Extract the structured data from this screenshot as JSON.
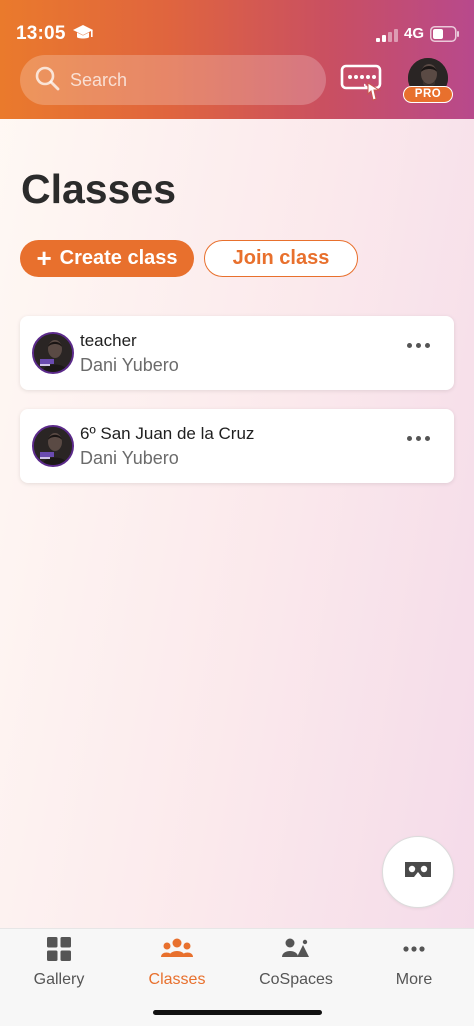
{
  "status_bar": {
    "time": "13:05",
    "network": "4G"
  },
  "header": {
    "search_placeholder": "Search",
    "pro_badge": "PRO"
  },
  "page": {
    "title": "Classes",
    "create_button": "Create class",
    "join_button": "Join class"
  },
  "classes": [
    {
      "name": "teacher",
      "owner": "Dani Yubero"
    },
    {
      "name": "6º San Juan de la Cruz",
      "owner": "Dani Yubero"
    }
  ],
  "tabbar": {
    "items": [
      {
        "label": "Gallery",
        "icon": "grid-icon"
      },
      {
        "label": "Classes",
        "icon": "people-icon"
      },
      {
        "label": "CoSpaces",
        "icon": "cospaces-icon"
      },
      {
        "label": "More",
        "icon": "more-dots-icon"
      }
    ],
    "active": "Classes"
  },
  "colors": {
    "accent": "#e8702d",
    "header_start": "#ea7a2c",
    "header_end": "#b8498c"
  }
}
